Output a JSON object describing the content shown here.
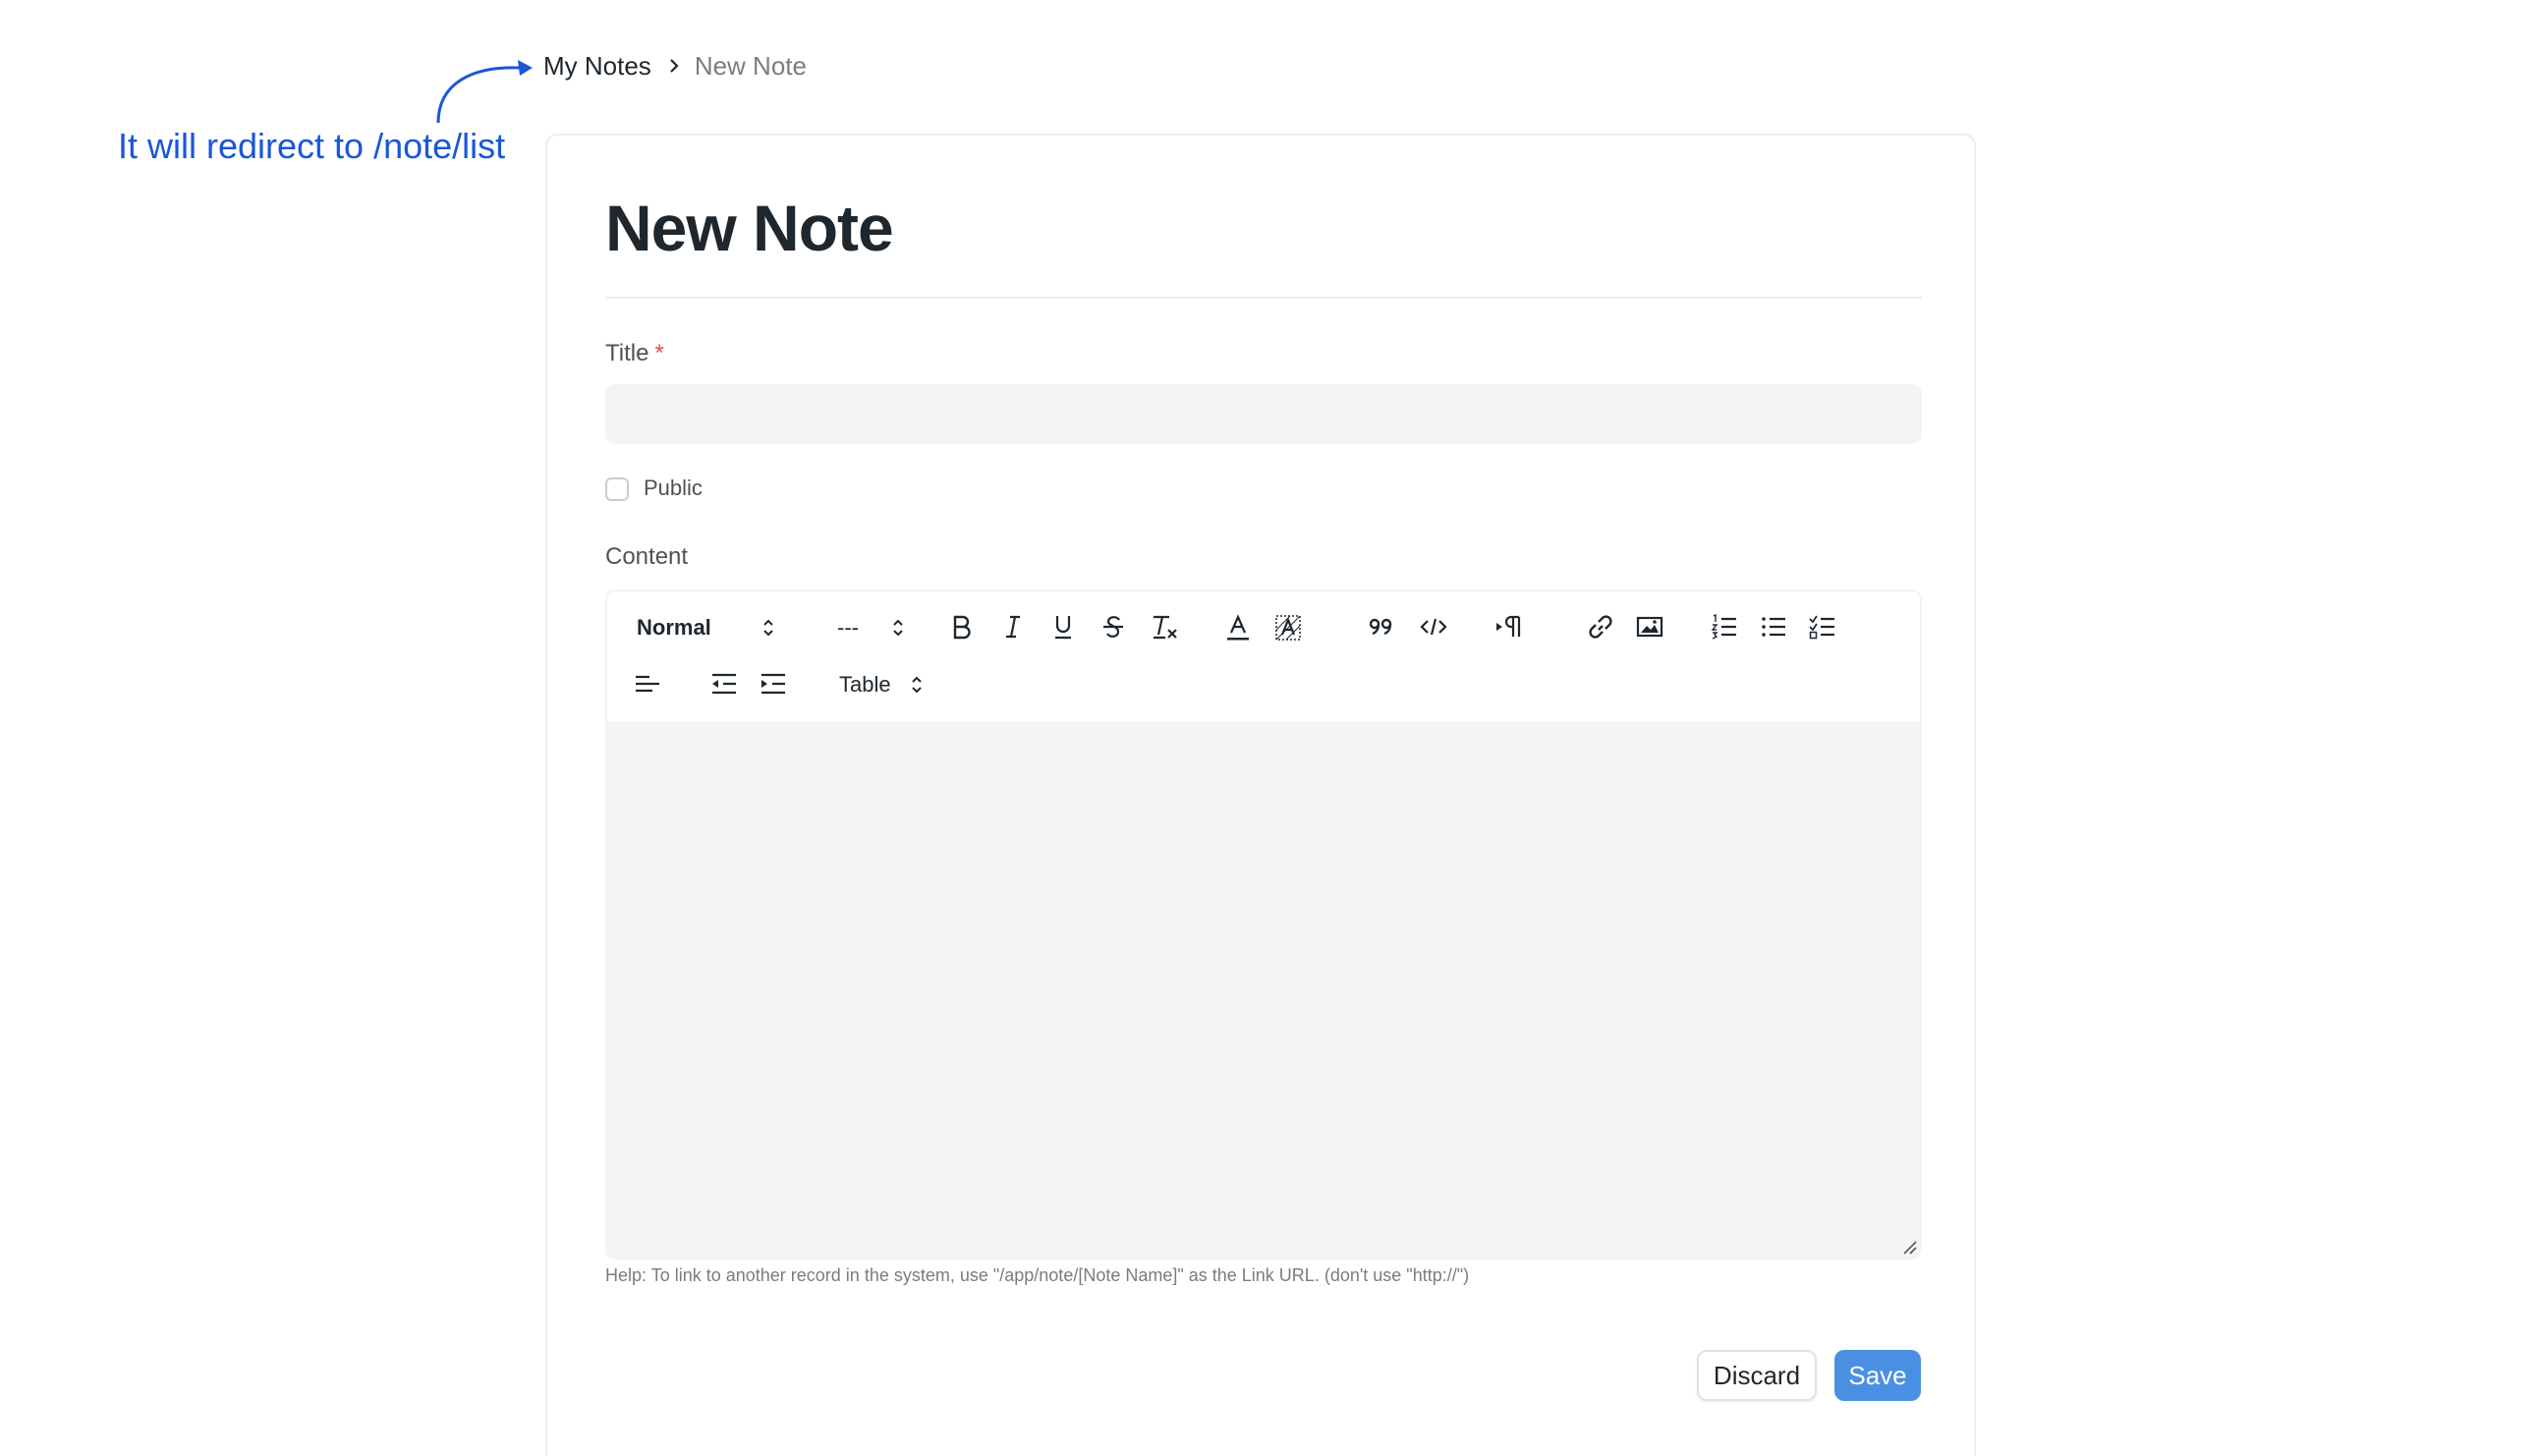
{
  "annotation": {
    "text": "It will redirect to /note/list"
  },
  "breadcrumb": {
    "parent": "My Notes",
    "current": "New Note"
  },
  "page": {
    "title": "New Note"
  },
  "form": {
    "title_label": "Title",
    "required_marker": "*",
    "title_value": "",
    "public_label": "Public",
    "public_checked": false,
    "content_label": "Content",
    "content_value": "",
    "help_text": "Help: To link to another record in the system, use \"/app/note/[Note Name]\" as the Link URL. (don't use \"http://\")"
  },
  "toolbar": {
    "block_format": "Normal",
    "font_size": "---",
    "table_label": "Table",
    "icons": [
      "bold-icon",
      "italic-icon",
      "underline-icon",
      "strikethrough-icon",
      "clear-format-icon",
      "font-color-icon",
      "background-color-icon",
      "blockquote-icon",
      "code-block-icon",
      "text-direction-icon",
      "link-icon",
      "image-icon",
      "ordered-list-icon",
      "bullet-list-icon",
      "checklist-icon",
      "align-left-icon",
      "outdent-icon",
      "indent-icon"
    ]
  },
  "actions": {
    "discard_label": "Discard",
    "save_label": "Save"
  },
  "colors": {
    "annotation": "#1a56db",
    "save_button": "#4a90e2",
    "required": "#e24c4c",
    "input_bg": "#f3f4f6"
  }
}
